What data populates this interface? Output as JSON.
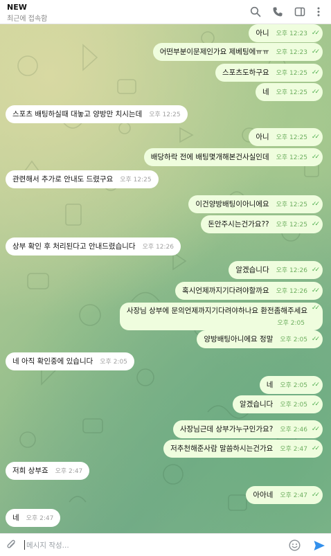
{
  "header": {
    "title": "NEW",
    "status": "최근에 접속함"
  },
  "icons": {
    "search": "search-icon",
    "call": "phone-icon",
    "sidebar": "sidebar-toggle-icon",
    "more": "more-vertical-icon",
    "attach": "paperclip-icon",
    "emoji": "smile-icon",
    "send": "send-icon"
  },
  "colors": {
    "outgoing_bubble": "#effdde",
    "incoming_bubble": "#ffffff",
    "check": "#4fae4e",
    "send": "#3390ec"
  },
  "messages": [
    {
      "dir": "out",
      "text": "아니",
      "time": "오후 12:23",
      "read": true
    },
    {
      "dir": "out",
      "text": "어떤부분이문제인가요 제베팅에ㅠㅠ",
      "time": "오후 12:23",
      "read": true
    },
    {
      "dir": "out",
      "text": "스포츠도하구요",
      "time": "오후 12:25",
      "read": true
    },
    {
      "dir": "out",
      "text": "네",
      "time": "오후 12:25",
      "read": true
    },
    {
      "dir": "in",
      "text": "스포츠 배팅하실때 대놓고 양방만 치시는데",
      "time": "오후 12:25"
    },
    {
      "dir": "out",
      "text": "아니",
      "time": "오후 12:25",
      "read": true
    },
    {
      "dir": "out",
      "text": "배당하락 전에 배팅몇개해본건사실인데",
      "time": "오후 12:25",
      "read": true
    },
    {
      "dir": "in",
      "text": "관련해서 추가로 안내도 드렸구요",
      "time": "오후 12:25"
    },
    {
      "dir": "out",
      "text": "이건양방배팅이아니에요",
      "time": "오후 12:25",
      "read": true
    },
    {
      "dir": "out",
      "text": "돈안주시는건가요??",
      "time": "오후 12:25",
      "read": true
    },
    {
      "dir": "in",
      "text": "상부 확인 후 처리된다고 안내드렸습니다",
      "time": "오후 12:26"
    },
    {
      "dir": "out",
      "text": "알겠습니다",
      "time": "오후 12:26",
      "read": true
    },
    {
      "dir": "out",
      "text": "혹시언제까지기다려야할까요",
      "time": "오후 12:26",
      "read": true
    },
    {
      "dir": "out",
      "text": "사장님 상부에 문의언제까지기다려야하나요 환전좀해주세요",
      "time": "오후 2:05",
      "read": true
    },
    {
      "dir": "out",
      "text": "양방배팅아니에요 정말",
      "time": "오후 2:05",
      "read": true
    },
    {
      "dir": "in",
      "text": "네 아직 확인중에 있습니다",
      "time": "오후 2:05"
    },
    {
      "dir": "out",
      "text": "네",
      "time": "오후 2:05",
      "read": true
    },
    {
      "dir": "out",
      "text": "알겠습니다",
      "time": "오후 2:05",
      "read": true
    },
    {
      "dir": "out",
      "text": "사장님근데 상부가누구인가요?",
      "time": "오후 2:46",
      "read": true
    },
    {
      "dir": "out",
      "text": "저추천해준사람 말씀하시는건가요",
      "time": "오후 2:47",
      "read": true
    },
    {
      "dir": "in",
      "text": "저희 상부죠",
      "time": "오후 2:47"
    },
    {
      "dir": "out",
      "text": "아아네",
      "time": "오후 2:47",
      "read": true
    },
    {
      "dir": "in",
      "text": "네",
      "time": "오후 2:47"
    }
  ],
  "composer": {
    "placeholder": "메시지 작성..."
  }
}
